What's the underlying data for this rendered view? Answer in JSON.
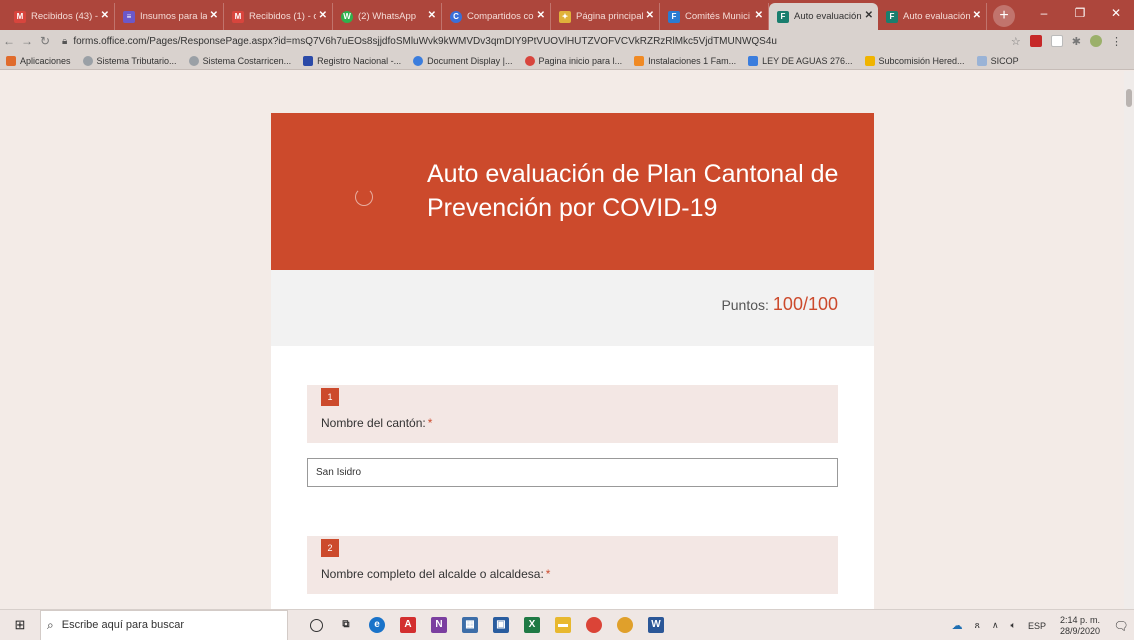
{
  "browser": {
    "tabs": [
      {
        "title": "Recibidos (43) -",
        "fav_color": "#d8453d",
        "fav_glyph": "M",
        "active": false
      },
      {
        "title": "Insumos para la",
        "fav_color": "#6b58c9",
        "fav_glyph": "≡",
        "active": false
      },
      {
        "title": "Recibidos (1) - c",
        "fav_color": "#d8453d",
        "fav_glyph": "M",
        "active": false
      },
      {
        "title": "(2) WhatsApp",
        "fav_color": "#2fb14c",
        "fav_glyph": "W",
        "active": false
      },
      {
        "title": "Compartidos co",
        "fav_color": "#3a6fd8",
        "fav_glyph": "C",
        "active": false
      },
      {
        "title": "Página principal",
        "fav_color": "#e0b23a",
        "fav_glyph": "✦",
        "active": false
      },
      {
        "title": "Comités Munici",
        "fav_color": "#2b7bd0",
        "fav_glyph": "F",
        "active": false
      },
      {
        "title": "Auto evaluación",
        "fav_color": "#1a7e6e",
        "fav_glyph": "F",
        "active": true
      },
      {
        "title": "Auto evaluación",
        "fav_color": "#1a7e6e",
        "fav_glyph": "F",
        "active": false
      }
    ],
    "new_tab": "+",
    "window_controls": {
      "minimize": "–",
      "maximize": "❐",
      "close": "✕"
    },
    "url": "forms.office.com/Pages/ResponsePage.aspx?id=msQ7V6h7uEOs8sjjdfoSMluWvk9kWMVDv3qmDIY9PtVUOVlHUTZVOFVCVkRZRzRlMkc5VjdTMUNWQS4u",
    "bookmarks": [
      {
        "label": "Aplicaciones",
        "color": "#e06b2c"
      },
      {
        "label": "Sistema Tributario...",
        "color": "#9aa0a6"
      },
      {
        "label": "Sistema Costarricen...",
        "color": "#9aa0a6"
      },
      {
        "label": "Registro Nacional -...",
        "color": "#2b4aa8"
      },
      {
        "label": "Document Display |...",
        "color": "#3b7ddd"
      },
      {
        "label": "Pagina inicio para l...",
        "color": "#d8453d"
      },
      {
        "label": "Instalaciones 1 Fam...",
        "color": "#f08a24"
      },
      {
        "label": "LEY DE AGUAS 276...",
        "color": "#3b7ddd"
      },
      {
        "label": "Subcomisión Hered...",
        "color": "#f0b400"
      },
      {
        "label": "SICOP",
        "color": "#9ab3d6"
      }
    ]
  },
  "form": {
    "title": "Auto evaluación de Plan Cantonal de Prevención por COVID-19",
    "score_label": "Puntos:",
    "score_value": "100/100",
    "accent": "#cc4a2c",
    "questions": [
      {
        "number": "1",
        "text": "Nombre del cantón:",
        "required": "*",
        "answer": "San Isidro"
      },
      {
        "number": "2",
        "text": "Nombre completo del alcalde o alcaldesa:",
        "required": "*",
        "answer": ""
      }
    ]
  },
  "taskbar": {
    "search_placeholder": "Escribe aquí para buscar",
    "apps": [
      {
        "icon": "cortana-icon",
        "color": "#333333",
        "glyph": "○"
      },
      {
        "icon": "task-view-icon",
        "color": "#333333",
        "glyph": "⧉"
      },
      {
        "icon": "edge-icon",
        "color": "#1a73c9",
        "glyph": "e"
      },
      {
        "icon": "acrobat-icon",
        "color": "#d32f2f",
        "glyph": "A"
      },
      {
        "icon": "onenote-icon",
        "color": "#7b3fa0",
        "glyph": "N"
      },
      {
        "icon": "calculator-icon",
        "color": "#3d6ea8",
        "glyph": "▦"
      },
      {
        "icon": "photos-icon",
        "color": "#2a5d9f",
        "glyph": "▣"
      },
      {
        "icon": "excel-icon",
        "color": "#1f7a45",
        "glyph": "X"
      },
      {
        "icon": "file-explorer-icon",
        "color": "#e8b82e",
        "glyph": "▬"
      },
      {
        "icon": "chrome-icon",
        "color": "#db4437",
        "glyph": "●"
      },
      {
        "icon": "chrome-alt-icon",
        "color": "#e0a02b",
        "glyph": "●"
      },
      {
        "icon": "word-icon",
        "color": "#2b5797",
        "glyph": "W"
      }
    ],
    "tray": {
      "language": "ESP",
      "time": "2:14 p. m.",
      "date": "28/9/2020"
    }
  }
}
